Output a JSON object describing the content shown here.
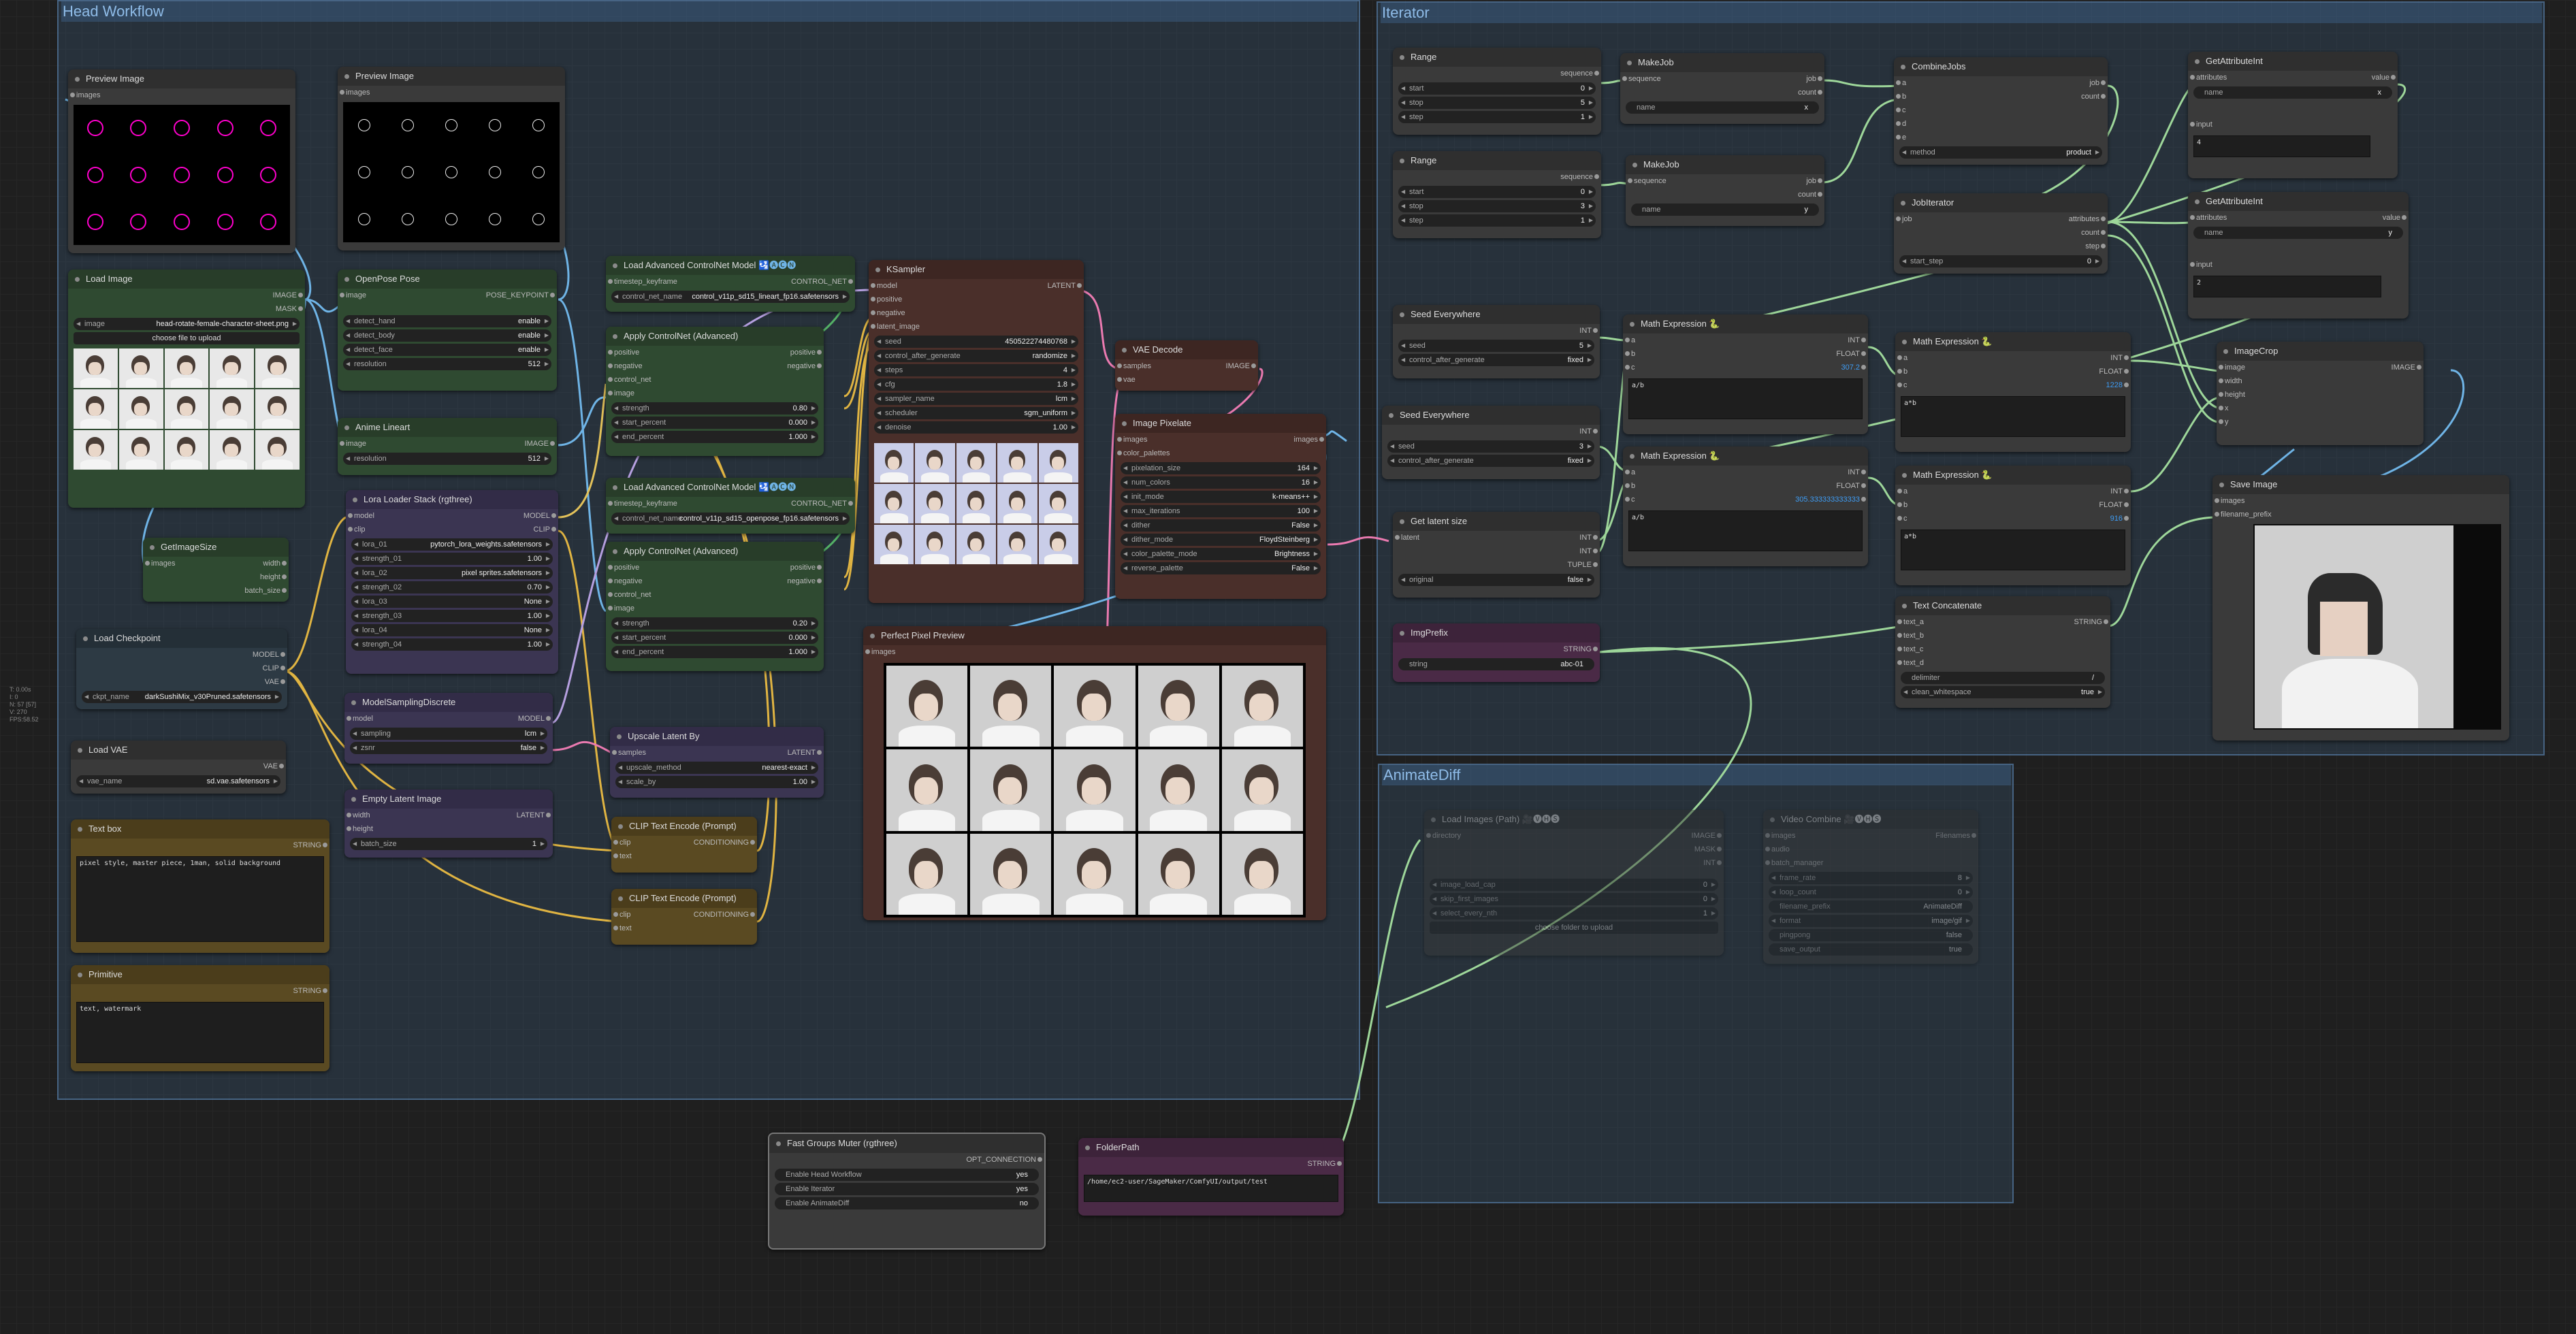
{
  "groups": {
    "head": "Head Workflow",
    "iter": "Iterator",
    "animate": "AnimateDiff"
  },
  "stats": [
    "T: 0.00s",
    "I: 0",
    "N: 57 [57]",
    "V: 270",
    "FPS:58.52"
  ],
  "preview1": {
    "title": "Preview Image",
    "images": "images"
  },
  "preview2": {
    "title": "Preview Image",
    "images": "images"
  },
  "loadimage": {
    "title": "Load Image",
    "image_out": "IMAGE",
    "mask_out": "MASK",
    "image_key": "image",
    "image_val": "head-rotate-female-character-sheet.png",
    "upload": "choose file to upload"
  },
  "openpose": {
    "title": "OpenPose Pose",
    "image": "image",
    "out": "POSE_KEYPOINT",
    "w": [
      {
        "k": "detect_hand",
        "v": "enable"
      },
      {
        "k": "detect_body",
        "v": "enable"
      },
      {
        "k": "detect_face",
        "v": "enable"
      },
      {
        "k": "resolution",
        "v": "512"
      }
    ]
  },
  "anime": {
    "title": "Anime Lineart",
    "image": "image",
    "out": "IMAGE",
    "rk": "resolution",
    "rv": "512"
  },
  "getimagesize": {
    "title": "GetImageSize",
    "images": "images",
    "width": "width",
    "height": "height",
    "batch": "batch_size"
  },
  "loadckpt": {
    "title": "Load Checkpoint",
    "model": "MODEL",
    "clip": "CLIP",
    "vae": "VAE",
    "ck": "ckpt_name",
    "cv": "darkSushiMix_v30Pruned.safetensors"
  },
  "loadvae": {
    "title": "Load VAE",
    "vae": "VAE",
    "k": "vae_name",
    "v": "sd.vae.safetensors"
  },
  "textbox": {
    "title": "Text box",
    "out": "STRING",
    "text": "pixel style, master piece, 1man, solid background"
  },
  "primitive": {
    "title": "Primitive",
    "out": "STRING",
    "text": "text, watermark"
  },
  "lora": {
    "title": "Lora Loader Stack (rgthree)",
    "model": "model",
    "clip": "clip",
    "mout": "MODEL",
    "cout": "CLIP",
    "w": [
      {
        "k": "lora_01",
        "v": "pytorch_lora_weights.safetensors"
      },
      {
        "k": "strength_01",
        "v": "1.00"
      },
      {
        "k": "lora_02",
        "v": "pixel sprites.safetensors"
      },
      {
        "k": "strength_02",
        "v": "0.70"
      },
      {
        "k": "lora_03",
        "v": "None"
      },
      {
        "k": "strength_03",
        "v": "1.00"
      },
      {
        "k": "lora_04",
        "v": "None"
      },
      {
        "k": "strength_04",
        "v": "1.00"
      }
    ]
  },
  "msd": {
    "title": "ModelSamplingDiscrete",
    "model": "model",
    "out": "MODEL",
    "w": [
      {
        "k": "sampling",
        "v": "lcm"
      },
      {
        "k": "zsnr",
        "v": "false"
      }
    ]
  },
  "empty": {
    "title": "Empty Latent Image",
    "width": "width",
    "height": "height",
    "out": "LATENT",
    "bk": "batch_size",
    "bv": "1"
  },
  "lacn1": {
    "title": "Load Advanced ControlNet Model",
    "tk": "timestep_keyframe",
    "out": "CONTROL_NET",
    "ck": "control_net_name",
    "cv": "control_v11p_sd15_lineart_fp16.safetensors"
  },
  "acn1": {
    "title": "Apply ControlNet (Advanced)",
    "ins": [
      "positive",
      "negative",
      "control_net",
      "image"
    ],
    "outs": [
      "positive",
      "negative"
    ],
    "w": [
      {
        "k": "strength",
        "v": "0.80"
      },
      {
        "k": "start_percent",
        "v": "0.000"
      },
      {
        "k": "end_percent",
        "v": "1.000"
      }
    ]
  },
  "lacn2": {
    "title": "Load Advanced ControlNet Model",
    "tk": "timestep_keyframe",
    "out": "CONTROL_NET",
    "ck": "control_net_name",
    "cv": "control_v11p_sd15_openpose_fp16.safetensors"
  },
  "acn2": {
    "title": "Apply ControlNet (Advanced)",
    "ins": [
      "positive",
      "negative",
      "control_net",
      "image"
    ],
    "outs": [
      "positive",
      "negative"
    ],
    "w": [
      {
        "k": "strength",
        "v": "0.20"
      },
      {
        "k": "start_percent",
        "v": "0.000"
      },
      {
        "k": "end_percent",
        "v": "1.000"
      }
    ]
  },
  "upscale": {
    "title": "Upscale Latent By",
    "samples": "samples",
    "out": "LATENT",
    "w": [
      {
        "k": "upscale_method",
        "v": "nearest-exact"
      },
      {
        "k": "scale_by",
        "v": "1.00"
      }
    ]
  },
  "clip1": {
    "title": "CLIP Text Encode (Prompt)",
    "clip": "clip",
    "text": "text",
    "out": "CONDITIONING"
  },
  "clip2": {
    "title": "CLIP Text Encode (Prompt)",
    "clip": "clip",
    "text": "text",
    "out": "CONDITIONING"
  },
  "ksampler": {
    "title": "KSampler",
    "ins": [
      "model",
      "positive",
      "negative",
      "latent_image"
    ],
    "out": "LATENT",
    "w": [
      {
        "k": "seed",
        "v": "450522274480768"
      },
      {
        "k": "control_after_generate",
        "v": "randomize"
      },
      {
        "k": "steps",
        "v": "4"
      },
      {
        "k": "cfg",
        "v": "1.8"
      },
      {
        "k": "sampler_name",
        "v": "lcm"
      },
      {
        "k": "scheduler",
        "v": "sgm_uniform"
      },
      {
        "k": "denoise",
        "v": "1.00"
      }
    ]
  },
  "vaedecode": {
    "title": "VAE Decode",
    "samples": "samples",
    "vae": "vae",
    "out": "IMAGE"
  },
  "pixelate": {
    "title": "Image Pixelate",
    "images": "images",
    "palettes": "color_palettes",
    "out": "images",
    "w": [
      {
        "k": "pixelation_size",
        "v": "164"
      },
      {
        "k": "num_colors",
        "v": "16"
      },
      {
        "k": "init_mode",
        "v": "k-means++"
      },
      {
        "k": "max_iterations",
        "v": "100"
      },
      {
        "k": "dither",
        "v": "False"
      },
      {
        "k": "dither_mode",
        "v": "FloydSteinberg"
      },
      {
        "k": "color_palette_mode",
        "v": "Brightness"
      },
      {
        "k": "reverse_palette",
        "v": "False"
      }
    ]
  },
  "ppp": {
    "title": "Perfect Pixel Preview",
    "images": "images"
  },
  "range1": {
    "title": "Range",
    "out": "sequence",
    "w": [
      {
        "k": "start",
        "v": "0"
      },
      {
        "k": "stop",
        "v": "5"
      },
      {
        "k": "step",
        "v": "1"
      }
    ]
  },
  "range2": {
    "title": "Range",
    "out": "sequence",
    "w": [
      {
        "k": "start",
        "v": "0"
      },
      {
        "k": "stop",
        "v": "3"
      },
      {
        "k": "step",
        "v": "1"
      }
    ]
  },
  "makejob1": {
    "title": "MakeJob",
    "seq": "sequence",
    "job": "job",
    "count": "count",
    "nk": "name",
    "nv": "x"
  },
  "makejob2": {
    "title": "MakeJob",
    "seq": "sequence",
    "job": "job",
    "count": "count",
    "nk": "name",
    "nv": "y"
  },
  "combine": {
    "title": "CombineJobs",
    "ins": [
      "a",
      "b",
      "c",
      "d",
      "e"
    ],
    "outs": [
      "job",
      "count"
    ],
    "mk": "method",
    "mv": "product"
  },
  "jobiter": {
    "title": "JobIterator",
    "job": "job",
    "outs": [
      "attributes",
      "count",
      "step"
    ],
    "sk": "start_step",
    "sv": "0"
  },
  "getattr1": {
    "title": "GetAttributeInt",
    "attr": "attributes",
    "out": "value",
    "nk": "name",
    "nv": "x",
    "input": "input",
    "val": "4"
  },
  "getattr2": {
    "title": "GetAttributeInt",
    "attr": "attributes",
    "out": "value",
    "nk": "name",
    "nv": "y",
    "input": "input",
    "val": "2"
  },
  "seed1": {
    "title": "Seed Everywhere",
    "out": "INT",
    "w": [
      {
        "k": "seed",
        "v": "5"
      },
      {
        "k": "control_after_generate",
        "v": "fixed"
      }
    ]
  },
  "seed2": {
    "title": "Seed Everywhere",
    "out": "INT",
    "w": [
      {
        "k": "seed",
        "v": "3"
      },
      {
        "k": "control_after_generate",
        "v": "fixed"
      }
    ]
  },
  "latsize": {
    "title": "Get latent size",
    "latent": "latent",
    "outs": [
      "INT",
      "INT",
      "TUPLE"
    ],
    "ok": "original",
    "ov": "false"
  },
  "imgprefix": {
    "title": "ImgPrefix",
    "out": "STRING",
    "k": "string",
    "v": "abc-01"
  },
  "math1": {
    "title": "Math Expression 🐍",
    "ins": [
      "a",
      "b",
      "c"
    ],
    "outs": [
      "INT",
      "FLOAT"
    ],
    "res": "307.2",
    "expr": "a/b"
  },
  "math2": {
    "title": "Math Expression 🐍",
    "ins": [
      "a",
      "b",
      "c"
    ],
    "outs": [
      "INT",
      "FLOAT"
    ],
    "res": "1228",
    "expr": "a*b"
  },
  "math3": {
    "title": "Math Expression 🐍",
    "ins": [
      "a",
      "b",
      "c"
    ],
    "outs": [
      "INT",
      "FLOAT"
    ],
    "res": "305.333333333333",
    "expr": "a/b"
  },
  "math4": {
    "title": "Math Expression 🐍",
    "ins": [
      "a",
      "b",
      "c"
    ],
    "outs": [
      "INT",
      "FLOAT"
    ],
    "res": "916",
    "expr": "a*b"
  },
  "crop": {
    "title": "ImageCrop",
    "ins": [
      "image",
      "width",
      "height",
      "x",
      "y"
    ],
    "out": "IMAGE"
  },
  "save": {
    "title": "Save Image",
    "images": "images",
    "prefix": "filename_prefix"
  },
  "concat": {
    "title": "Text Concatenate",
    "ins": [
      "text_a",
      "text_b",
      "text_c",
      "text_d"
    ],
    "out": "STRING",
    "w": [
      {
        "k": "delimiter",
        "v": "/"
      },
      {
        "k": "clean_whitespace",
        "v": "true"
      }
    ]
  },
  "loadimages": {
    "title": "Load Images (Path) 🎥🅥🅗🅢",
    "dir": "directory",
    "outs": [
      "IMAGE",
      "MASK",
      "INT"
    ],
    "w": [
      {
        "k": "image_load_cap",
        "v": "0"
      },
      {
        "k": "skip_first_images",
        "v": "0"
      },
      {
        "k": "select_every_nth",
        "v": "1"
      }
    ],
    "upload": "choose folder to upload"
  },
  "videocombine": {
    "title": "Video Combine 🎥🅥🅗🅢",
    "ins": [
      "images",
      "audio",
      "batch_manager"
    ],
    "out": "Filenames",
    "w": [
      {
        "k": "frame_rate",
        "v": "8"
      },
      {
        "k": "loop_count",
        "v": "0"
      },
      {
        "k": "filename_prefix",
        "v": "AnimateDiff"
      },
      {
        "k": "format",
        "v": "image/gif"
      },
      {
        "k": "pingpong",
        "v": "false"
      },
      {
        "k": "save_output",
        "v": "true"
      }
    ]
  },
  "muter": {
    "title": "Fast Groups Muter (rgthree)",
    "out": "OPT_CONNECTION",
    "rows": [
      {
        "k": "Enable Head Workflow",
        "v": "yes"
      },
      {
        "k": "Enable Iterator",
        "v": "yes"
      },
      {
        "k": "Enable AnimateDiff",
        "v": "no"
      }
    ]
  },
  "folderpath": {
    "title": "FolderPath",
    "out": "STRING",
    "path": "/home/ec2-user/SageMaker/ComfyUI/output/test"
  }
}
